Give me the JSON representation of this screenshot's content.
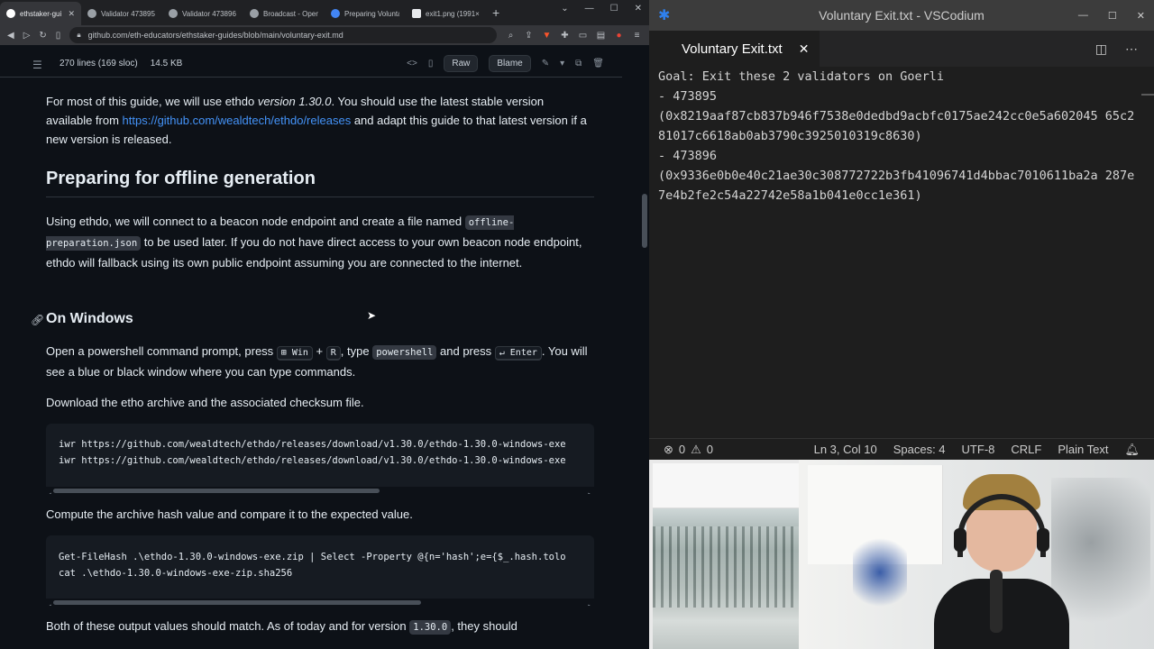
{
  "browser": {
    "tabs": [
      {
        "label": "ethstaker-gui",
        "icon": "github-icon",
        "active": true
      },
      {
        "label": "Validator 473895",
        "icon": "beaconcha-icon"
      },
      {
        "label": "Validator 473896",
        "icon": "beaconcha-icon"
      },
      {
        "label": "Broadcast - Open",
        "icon": "beaconcha-icon"
      },
      {
        "label": "Preparing Volunta",
        "icon": "doc-icon"
      },
      {
        "label": "exit1.png (1991×",
        "icon": "image-icon"
      }
    ],
    "url": "github.com/eth-educators/ethstaker-guides/blob/main/voluntary-exit.md"
  },
  "file": {
    "lines": "270 lines (169 sloc)",
    "size": "14.5 KB",
    "raw": "Raw",
    "blame": "Blame"
  },
  "article": {
    "intro_a": "For most of this guide, we will use ethdo ",
    "intro_em": "version 1.30.0",
    "intro_b": ". You should use the latest stable version available from ",
    "intro_link": "https://github.com/wealdtech/ethdo/releases",
    "intro_c": " and adapt this guide to that latest version if a new version is released.",
    "h2": "Preparing for offline generation",
    "prep_a": "Using ethdo, we will connect to a beacon node endpoint and create a file named ",
    "prep_code": "offline-preparation.json",
    "prep_b": " to be used later. If you do not have direct access to your own beacon node endpoint, ethdo will fallback using its own public endpoint assuming you are connected to the internet.",
    "h3": "On Windows",
    "win_a": "Open a powershell command prompt, press ",
    "win_k1": "⊞ Win",
    "win_plus": " + ",
    "win_k2": "R",
    "win_b": ", type ",
    "win_code": "powershell",
    "win_c": " and press ",
    "win_k3": "↵ Enter",
    "win_d": ". You will see a blue or black window where you can type commands.",
    "download": "Download the etho archive and the associated checksum file.",
    "code1": [
      "iwr https://github.com/wealdtech/ethdo/releases/download/v1.30.0/ethdo-1.30.0-windows-exe",
      "iwr https://github.com/wealdtech/ethdo/releases/download/v1.30.0/ethdo-1.30.0-windows-exe"
    ],
    "compute": "Compute the archive hash value and compare it to the expected value.",
    "code2": [
      "Get-FileHash .\\ethdo-1.30.0-windows-exe.zip | Select -Property @{n='hash';e={$_.hash.tolo",
      "cat .\\ethdo-1.30.0-windows-exe-zip.sha256"
    ],
    "both_a": "Both of these output values should match. As of today and for version ",
    "both_code": "1.30.0",
    "both_b": ", they should"
  },
  "editor": {
    "title": "Voluntary Exit.txt - VSCodium",
    "tab": "Voluntary Exit.txt",
    "lines": [
      "Goal: Exit these 2 validators on Goerli",
      "",
      "- 473895",
      "(0x8219aaf87cb837b946f7538e0dedbd9acbfc0175ae242cc0e5a602045 65c281017c6618ab0ab3790c3925010319c8630)",
      "- 473896",
      "(0x9336e0b0e40c21ae30c308772722b3fb41096741d4bbac7010611ba2a 287e7e4b2fe2c54a22742e58a1b041e0cc1e361)"
    ],
    "status": {
      "errors": "0",
      "warnings": "0",
      "position": "Ln 3, Col 10",
      "spaces": "Spaces: 4",
      "encoding": "UTF-8",
      "eol": "CRLF",
      "language": "Plain Text"
    }
  },
  "colors": {
    "link": "#4493f8",
    "bg": "#0d1117",
    "editor_bg": "#1e1e1e"
  }
}
